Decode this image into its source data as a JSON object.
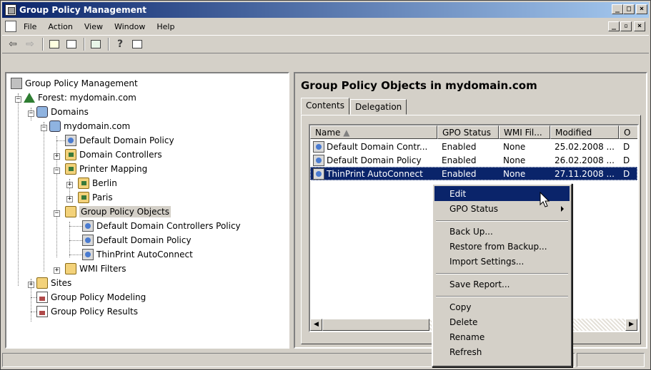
{
  "window": {
    "title": "Group Policy Management",
    "controls": {
      "minimize": "_",
      "maximize": "□",
      "close": "×"
    },
    "child_controls": {
      "minimize": "_",
      "restore": "▫",
      "close": "×"
    }
  },
  "menu": [
    "File",
    "Action",
    "View",
    "Window",
    "Help"
  ],
  "toolbar": {
    "buttons": [
      "back-icon",
      "forward-icon",
      "up-folder-icon",
      "show-hide-tree-icon",
      "refresh-icon",
      "help-icon",
      "properties-icon"
    ],
    "glyphs": {
      "back": "⇦",
      "forward": "⇨",
      "help": "?"
    }
  },
  "tree": {
    "root": "Group Policy Management",
    "forest": "Forest: mydomain.com",
    "domains": "Domains",
    "domain": "mydomain.com",
    "default_domain_policy": "Default Domain Policy",
    "domain_controllers": "Domain Controllers",
    "printer_mapping": "Printer Mapping",
    "berlin": "Berlin",
    "paris": "Paris",
    "gpo_folder": "Group Policy Objects",
    "gpo_ddcp": "Default Domain Controllers Policy",
    "gpo_ddp": "Default Domain Policy",
    "gpo_thinprint": "ThinPrint AutoConnect",
    "wmi_filters": "WMI Filters",
    "sites": "Sites",
    "modeling": "Group Policy Modeling",
    "results": "Group Policy Results"
  },
  "details": {
    "title": "Group Policy Objects in mydomain.com",
    "tabs": [
      "Contents",
      "Delegation"
    ],
    "columns": [
      "Name",
      "GPO Status",
      "WMI Fil...",
      "Modified",
      "O"
    ],
    "sort_indicator": "▲",
    "rows": [
      {
        "name": "Default Domain Contr...",
        "status": "Enabled",
        "wmi": "None",
        "modified": "25.02.2008 ...",
        "owner": "D"
      },
      {
        "name": "Default Domain Policy",
        "status": "Enabled",
        "wmi": "None",
        "modified": "26.02.2008 ...",
        "owner": "D"
      },
      {
        "name": "ThinPrint AutoConnect",
        "status": "Enabled",
        "wmi": "None",
        "modified": "27.11.2008 ...",
        "owner": "D"
      }
    ],
    "scroll_left": "◀",
    "scroll_right": "▶"
  },
  "context_menu": {
    "items": [
      "Edit",
      "GPO Status",
      "Back Up...",
      "Restore from Backup...",
      "Import Settings...",
      "Save Report...",
      "Copy",
      "Delete",
      "Rename",
      "Refresh"
    ]
  },
  "colors": {
    "selection": "#0a246a",
    "face": "#d4d0c8",
    "title_start": "#0a246a",
    "title_end": "#a6caf0"
  }
}
